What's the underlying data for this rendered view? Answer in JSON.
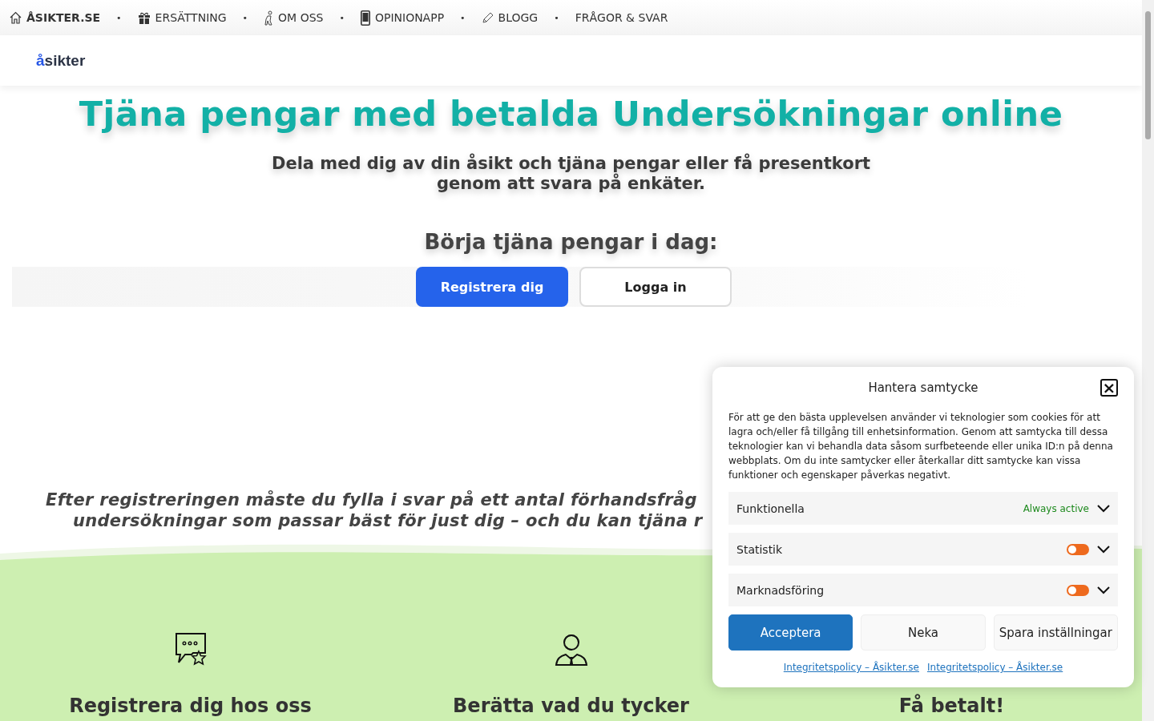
{
  "nav": [
    {
      "kind": "home",
      "label": "ÅSIKTER.SE"
    },
    {
      "kind": "separator",
      "label": "•"
    },
    {
      "kind": "gift",
      "label": "ERSÄTTNING"
    },
    {
      "kind": "separator",
      "label": "•"
    },
    {
      "kind": "person",
      "label": "OM OSS"
    },
    {
      "kind": "separator",
      "label": "•"
    },
    {
      "kind": "phone",
      "label": "OPINIONAPP"
    },
    {
      "kind": "separator",
      "label": "•"
    },
    {
      "kind": "pencil",
      "label": "BLOGG"
    },
    {
      "kind": "separator",
      "label": "•"
    },
    {
      "kind": "plain",
      "label": "FRÅGOR & SVAR"
    }
  ],
  "logo": {
    "mark": "å",
    "text": "sikter"
  },
  "hero": {
    "title": "Tjäna pengar med betalda Undersökningar online",
    "subtitle": "Dela med dig av din åsikt och tjäna pengar eller få presentkort genom att svara på enkäter.",
    "cta_heading": "Börja tjäna pengar i dag:",
    "buttons": [
      {
        "label": "Registrera dig",
        "kind": "primary"
      },
      {
        "label": "Logga in",
        "kind": "outline"
      }
    ]
  },
  "intro_lines": [
    "Efter registreringen måste du fylla i svar på ett antal förhandsfråg",
    "undersökningar som passar bäst för just dig – och du kan tjäna r"
  ],
  "steps": [
    {
      "kind": "chat",
      "heading": "Registrera dig hos oss"
    },
    {
      "kind": "agent",
      "heading": "Berätta vad du tycker"
    },
    {
      "kind": "none",
      "heading": "Få betalt!"
    }
  ],
  "consent": {
    "title": "Hantera samtycke",
    "close": "×",
    "text": "För att ge den bästa upplevelsen använder vi teknologier som cookies för att lagra och/eller få tillgång till enhetsinformation. Genom att samtycka till dessa teknologier kan vi behandla data såsom surfbeteende eller unika ID:n på denna webbplats. Om du inte samtycker eller återkallar ditt samtycke kan vissa funktioner och egenskaper påverkas negativt.",
    "categories": [
      {
        "label": "Funktionella",
        "kind": "always",
        "status": "Always active",
        "expanded": false
      },
      {
        "label": "Statistik",
        "kind": "toggle",
        "on": false,
        "expanded": false
      },
      {
        "label": "Marknadsföring",
        "kind": "toggle",
        "on": false,
        "expanded": false
      }
    ],
    "buttons": [
      {
        "label": "Acceptera",
        "kind": "primary"
      },
      {
        "label": "Neka",
        "kind": "secondary"
      },
      {
        "label": "Spara inställningar",
        "kind": "secondary"
      }
    ],
    "links": [
      "Integritetspolicy – Åsikter.se",
      "Integritetspolicy – Åsikter.se"
    ]
  }
}
